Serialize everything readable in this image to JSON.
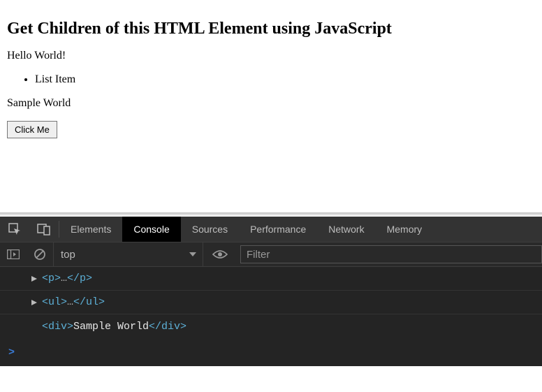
{
  "page": {
    "heading": "Get Children of this HTML Element using JavaScript",
    "paragraph": "Hello World!",
    "listItem": "List Item",
    "sample": "Sample World",
    "button": "Click Me"
  },
  "devtools": {
    "tabs": {
      "elements": "Elements",
      "console": "Console",
      "sources": "Sources",
      "performance": "Performance",
      "network": "Network",
      "memory": "Memory"
    },
    "context": "top",
    "filterPlaceholder": "Filter",
    "log": {
      "row1_open": "<p>",
      "row1_dots": "…",
      "row1_close": "</p>",
      "row2_open": "<ul>",
      "row2_dots": "…",
      "row2_close": "</ul>",
      "row3_open": "<div>",
      "row3_text": "Sample World",
      "row3_close": "</div>"
    },
    "prompt": ">"
  }
}
